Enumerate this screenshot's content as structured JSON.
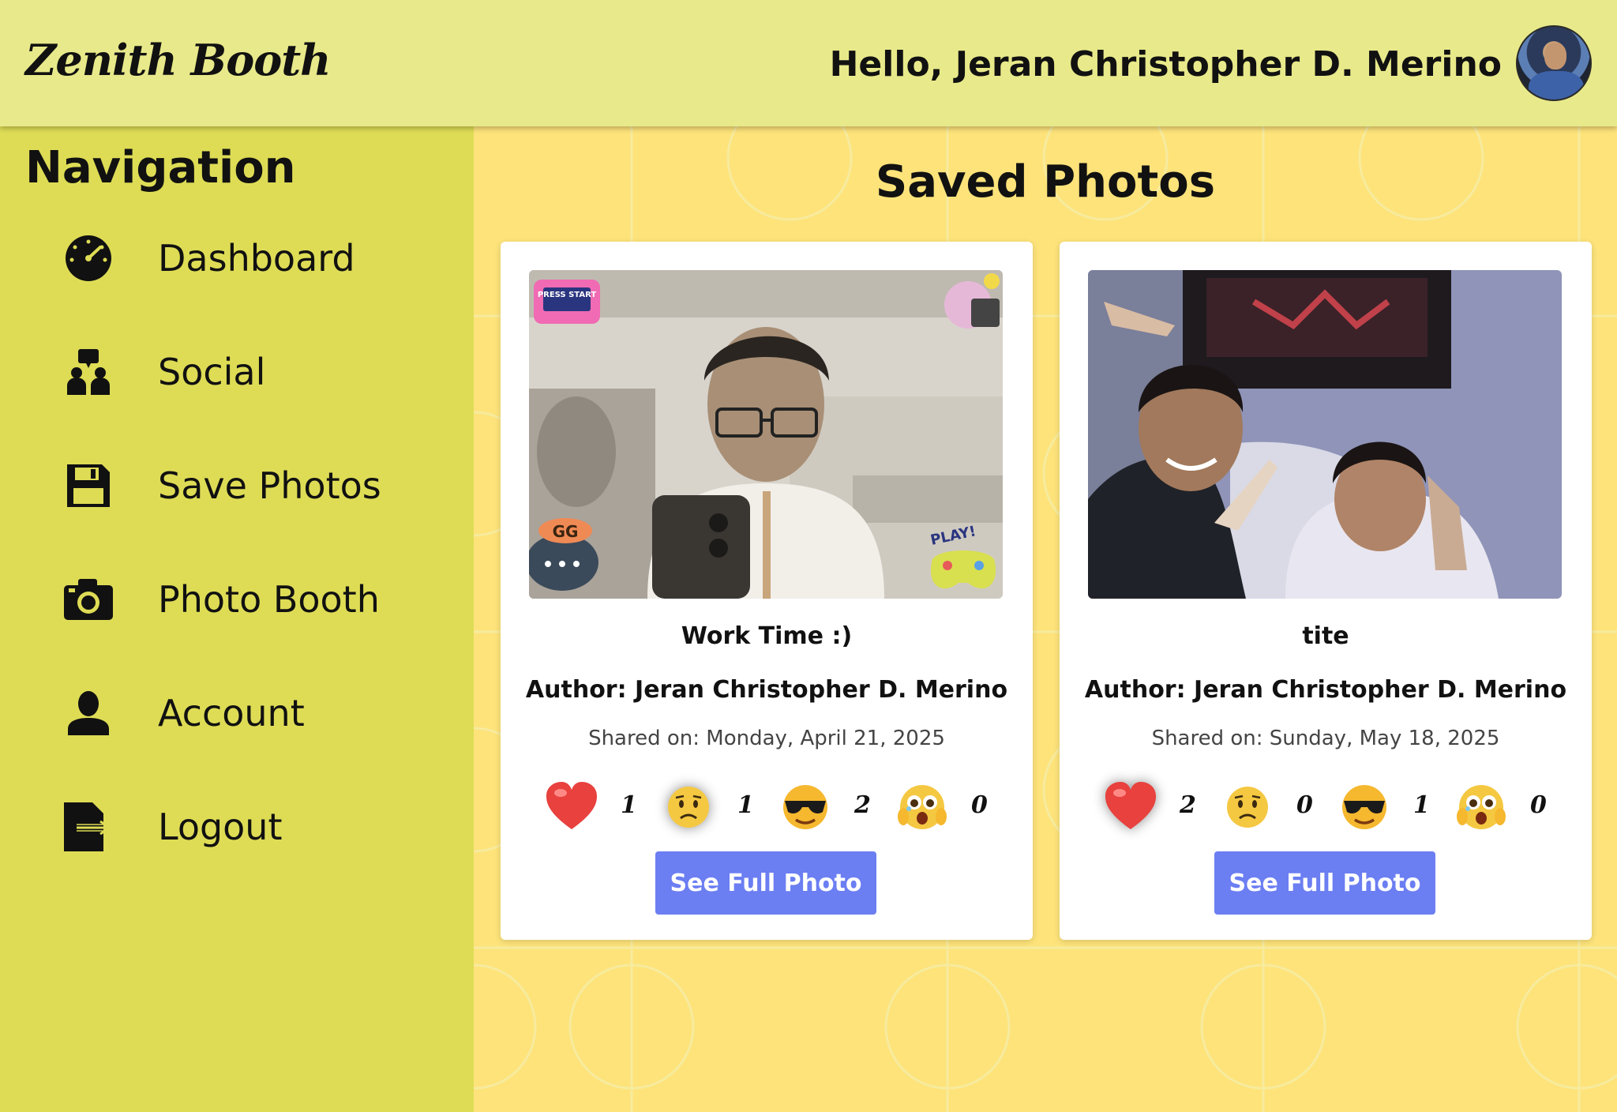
{
  "header": {
    "logo": "Zenith Booth",
    "greeting": "Hello, Jeran Christopher D. Merino"
  },
  "sidebar": {
    "title": "Navigation",
    "items": [
      {
        "label": "Dashboard",
        "icon": "speedometer-icon"
      },
      {
        "label": "Social",
        "icon": "users-icon"
      },
      {
        "label": "Save Photos",
        "icon": "floppy-disk-icon"
      },
      {
        "label": "Photo Booth",
        "icon": "camera-icon"
      },
      {
        "label": "Account",
        "icon": "user-icon"
      },
      {
        "label": "Logout",
        "icon": "logout-icon"
      }
    ]
  },
  "main": {
    "title": "Saved Photos",
    "cards": [
      {
        "caption": "Work Time :)",
        "author": "Author: Jeran Christopher D. Merino",
        "shared": "Shared on: Monday, April 21, 2025",
        "reactions": {
          "heart": "1",
          "sad": "1",
          "cool": "2",
          "shocked": "0"
        },
        "button": "See Full Photo",
        "stickers": [
          "PRESS START",
          "GG",
          "PLAY!"
        ]
      },
      {
        "caption": "tite",
        "author": "Author: Jeran Christopher D. Merino",
        "shared": "Shared on: Sunday, May 18, 2025",
        "reactions": {
          "heart": "2",
          "sad": "0",
          "cool": "1",
          "shocked": "0"
        },
        "button": "See Full Photo"
      }
    ]
  },
  "colors": {
    "header_bg": "#e8e98a",
    "sidebar_bg": "#dedc55",
    "main_bg": "#fde37a",
    "button_bg": "#6b7ef2"
  }
}
